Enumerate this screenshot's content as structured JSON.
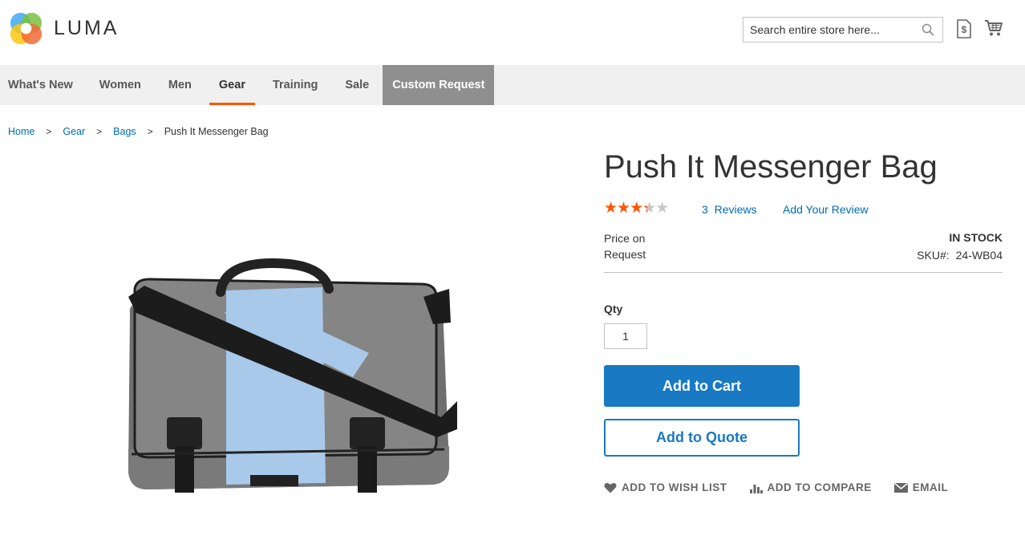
{
  "header": {
    "logo_text": "LUMA",
    "search_placeholder": "Search entire store here...",
    "icons": [
      "search-icon",
      "quote-icon",
      "cart-icon"
    ]
  },
  "nav": {
    "items": [
      {
        "label": "What's New",
        "active": false
      },
      {
        "label": "Women",
        "active": false
      },
      {
        "label": "Men",
        "active": false
      },
      {
        "label": "Gear",
        "active": true
      },
      {
        "label": "Training",
        "active": false
      },
      {
        "label": "Sale",
        "active": false
      },
      {
        "label": "Custom Request",
        "active": false
      }
    ]
  },
  "breadcrumbs": {
    "items": [
      "Home",
      "Gear",
      "Bags"
    ],
    "current": "Push It Messenger Bag",
    "separator": ">"
  },
  "product": {
    "title": "Push It Messenger Bag",
    "rating_percent": 60,
    "reviews_count": "3",
    "reviews_label": "Reviews",
    "add_review_label": "Add Your Review",
    "price_text": "Price on Request",
    "stock": "IN STOCK",
    "sku_label": "SKU#:",
    "sku": "24-WB04",
    "qty_label": "Qty",
    "qty_value": "1",
    "add_to_cart": "Add to Cart",
    "add_to_quote": "Add to Quote",
    "actions": {
      "wishlist": "ADD TO WISH LIST",
      "compare": "ADD TO COMPARE",
      "email": "EMAIL"
    }
  },
  "colors": {
    "accent": "#1979c3",
    "nav_active": "#ff5501",
    "link": "#006bb4",
    "star": "#ff5501",
    "nav_bg": "#f0f0f0",
    "custom_request_bg": "#8f8f8f"
  }
}
